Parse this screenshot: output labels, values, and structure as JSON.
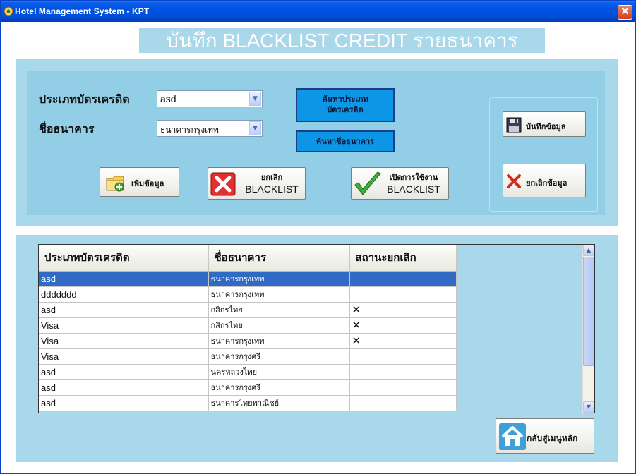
{
  "window": {
    "title": "Hotel Management System - KPT",
    "close_glyph": "✕"
  },
  "heading": "บันทึก BLACKLIST CREDIT รายธนาคาร",
  "form": {
    "card_type_label": "ประเภทบัตรเครดิต",
    "card_type_value": "asd",
    "bank_label": "ชื่อธนาคาร",
    "bank_value": "ธนาคารกรุงเทพ",
    "search_card_type_button": [
      "ค้นหาประเภท",
      "บัตรเครดิต"
    ],
    "search_bank_button": "ค้นหาชื่อธนาคาร",
    "add_button": "เพิ่มข้อมูล",
    "cancel_blacklist_button": [
      "ยกเลิก",
      "BLACKLIST"
    ],
    "enable_blacklist_button": [
      "เปิดการใช้งาน",
      "BLACKLIST"
    ],
    "save_button": "บันทึกข้อมูล",
    "cancel_button": "ยกเลิกข้อมูล"
  },
  "grid": {
    "columns": [
      "ประเภทบัตรเครดิต",
      "ชื่อธนาคาร",
      "สถานะยกเลิก"
    ],
    "rows": [
      {
        "card": "asd",
        "bank": "ธนาคารกรุงเทพ",
        "status": "",
        "selected": true
      },
      {
        "card": "ddddddd",
        "bank": "ธนาคารกรุงเทพ",
        "status": ""
      },
      {
        "card": "asd",
        "bank": "กสิกรไทย",
        "status": "✕"
      },
      {
        "card": "Visa",
        "bank": "กสิกรไทย",
        "status": "✕"
      },
      {
        "card": "Visa",
        "bank": "ธนาคารกรุงเทพ",
        "status": "✕"
      },
      {
        "card": "Visa",
        "bank": "ธนาคารกรุงศรี",
        "status": ""
      },
      {
        "card": "asd",
        "bank": "นครหลวงไทย",
        "status": ""
      },
      {
        "card": "asd",
        "bank": "ธนาคารกรุงศรี",
        "status": ""
      },
      {
        "card": "asd",
        "bank": "ธนาคารไทยพาณิชย์",
        "status": ""
      }
    ]
  },
  "back_button": "กลับสู่เมนูหลัก",
  "icons": {
    "app": "hotel-app-icon",
    "save": "floppy-disk-icon",
    "cancel": "red-x-icon",
    "add": "folder-add-icon",
    "cancel_blacklist": "red-x-box-icon",
    "enable_blacklist": "green-check-icon",
    "home": "home-icon"
  },
  "colors": {
    "panel": "#a8d8ea",
    "heading_bg": "#a8d8ea",
    "blue_button": "#0e96e6",
    "selection": "#316ac5"
  }
}
